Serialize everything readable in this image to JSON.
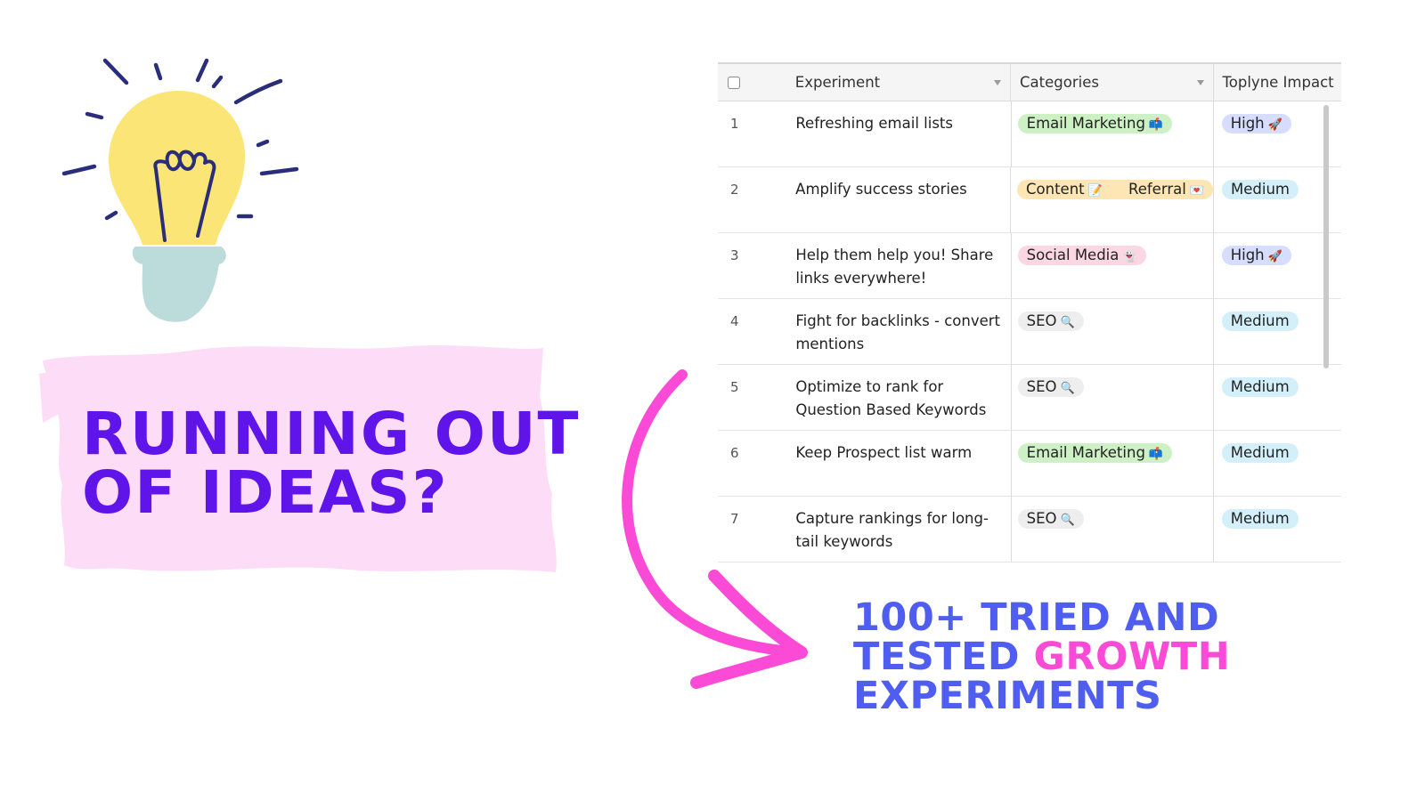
{
  "colors": {
    "headline": "#5f14ea",
    "brush": "#fcdcf7",
    "tagline": "#4f5ef0",
    "tagline_highlight": "#fb4bd6",
    "arrow": "#fb4bd6",
    "bulb_glass": "#fbe577",
    "bulb_base": "#bcdcdc",
    "bulb_lines": "#2a2e7a"
  },
  "headline": {
    "line1": "RUNNING OUT",
    "line2": "OF IDEAS?"
  },
  "tagline": {
    "line1": "100+ TRIED AND",
    "line2_a": "TESTED ",
    "line2_b": "GROWTH",
    "line3": "EXPERIMENTS"
  },
  "table": {
    "columns": {
      "experiment": "Experiment",
      "categories": "Categories",
      "impact": "Toplyne Impact"
    },
    "rows": [
      {
        "num": "1",
        "experiment": "Refreshing email lists",
        "categories": [
          {
            "label": "Email Marketing",
            "emoji": "📫",
            "color": "#cdf1c4"
          }
        ],
        "impact": {
          "label": "High",
          "emoji": "🚀",
          "color": "#d6ddff"
        }
      },
      {
        "num": "2",
        "experiment": "Amplify success stories",
        "categories": [
          {
            "label": "Content",
            "emoji": "📝",
            "color": "#fde6b3"
          },
          {
            "label": "Referral",
            "emoji": "💌",
            "color": "#fde6b3"
          }
        ],
        "impact": {
          "label": "Medium",
          "emoji": "",
          "color": "#d3f0fa"
        }
      },
      {
        "num": "3",
        "experiment": "Help them help you! Share links everywhere!",
        "categories": [
          {
            "label": "Social Media",
            "emoji": "👻",
            "color": "#fbd6e3"
          }
        ],
        "impact": {
          "label": "High",
          "emoji": "🚀",
          "color": "#d6ddff"
        }
      },
      {
        "num": "4",
        "experiment": "Fight for backlinks - convert mentions",
        "categories": [
          {
            "label": "SEO",
            "emoji": "🔍",
            "color": "#eeeeee"
          }
        ],
        "impact": {
          "label": "Medium",
          "emoji": "",
          "color": "#d3f0fa"
        }
      },
      {
        "num": "5",
        "experiment": "Optimize to rank for Question Based Keywords",
        "categories": [
          {
            "label": "SEO",
            "emoji": "🔍",
            "color": "#eeeeee"
          }
        ],
        "impact": {
          "label": "Medium",
          "emoji": "",
          "color": "#d3f0fa"
        }
      },
      {
        "num": "6",
        "experiment": "Keep Prospect list warm",
        "categories": [
          {
            "label": "Email Marketing",
            "emoji": "📫",
            "color": "#cdf1c4"
          }
        ],
        "impact": {
          "label": "Medium",
          "emoji": "",
          "color": "#d3f0fa"
        }
      },
      {
        "num": "7",
        "experiment": "Capture rankings for long-tail keywords",
        "categories": [
          {
            "label": "SEO",
            "emoji": "🔍",
            "color": "#eeeeee"
          }
        ],
        "impact": {
          "label": "Medium",
          "emoji": "",
          "color": "#d3f0fa"
        }
      }
    ]
  }
}
